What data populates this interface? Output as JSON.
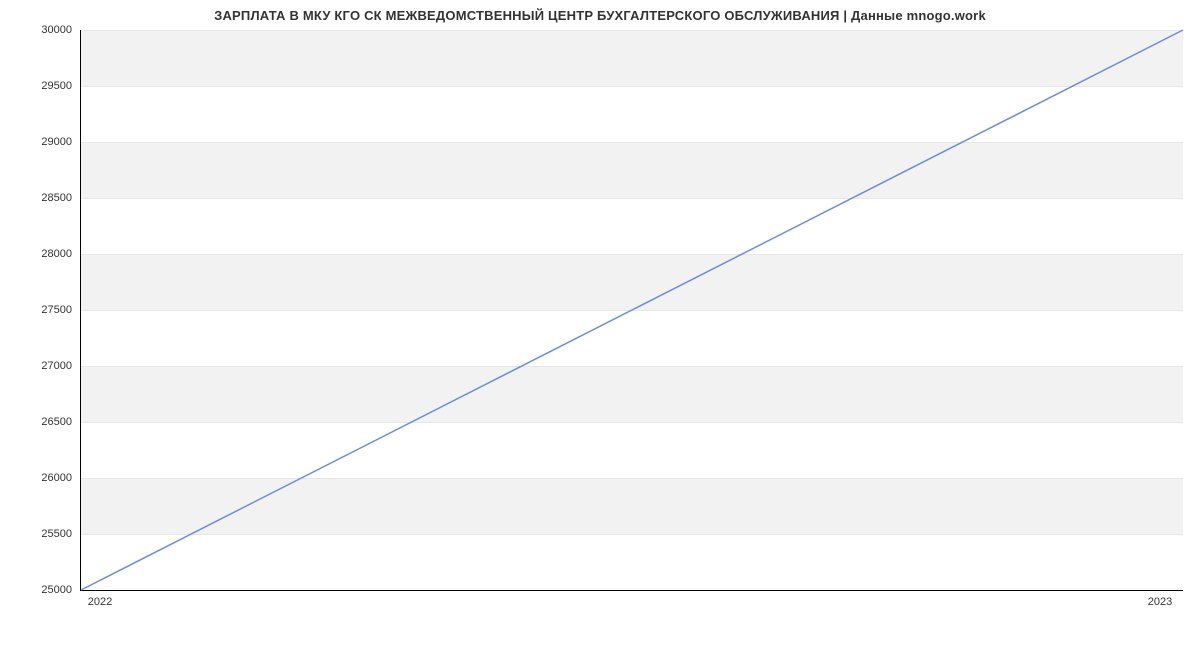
{
  "chart_data": {
    "type": "line",
    "title": "ЗАРПЛАТА В МКУ КГО СК МЕЖВЕДОМСТВЕННЫЙ ЦЕНТР БУХГАЛТЕРСКОГО ОБСЛУЖИВАНИЯ | Данные mnogo.work",
    "xlabel": "",
    "ylabel": "",
    "x": [
      "2022",
      "2023"
    ],
    "values": [
      25000,
      30000
    ],
    "ylim": [
      25000,
      30000
    ],
    "yticks": [
      25000,
      25500,
      26000,
      26500,
      27000,
      27500,
      28000,
      28500,
      29000,
      29500,
      30000
    ],
    "ytick_labels": [
      "25000",
      "25500",
      "26000",
      "26500",
      "27000",
      "27500",
      "28000",
      "28500",
      "29000",
      "29500",
      "30000"
    ],
    "xtick_labels": [
      "2022",
      "2023"
    ],
    "grid": true,
    "line_color": "#6a8fd8"
  }
}
